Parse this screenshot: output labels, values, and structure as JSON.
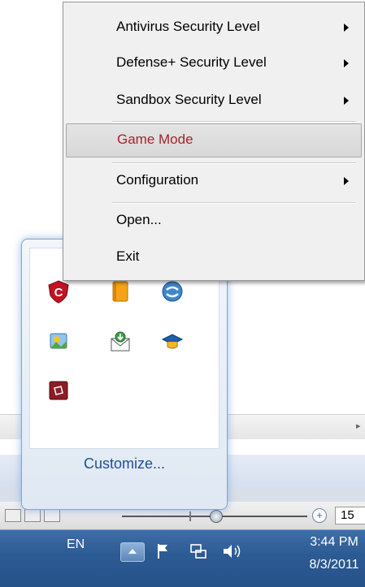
{
  "menu": {
    "items": [
      {
        "label": "Antivirus Security Level",
        "submenu": true
      },
      {
        "label": "Defense+ Security Level",
        "submenu": true
      },
      {
        "label": "Sandbox Security Level",
        "submenu": true
      },
      {
        "label": "Game Mode",
        "submenu": false,
        "highlighted": true
      },
      {
        "label": "Configuration",
        "submenu": true
      },
      {
        "label": "Open...",
        "submenu": false
      },
      {
        "label": "Exit",
        "submenu": false
      }
    ]
  },
  "flyout": {
    "icons": [
      "comodo-shield-icon",
      "notebook-icon",
      "network-sync-icon",
      "photo-icon",
      "mail-download-icon",
      "graduation-cap-icon",
      "maroon-app-icon"
    ],
    "customize_label": "Customize..."
  },
  "statusbar": {
    "zoom_value": "15"
  },
  "taskbar": {
    "language": "EN",
    "time": "3:44 PM",
    "date": "8/3/2011",
    "tray_icons": [
      "show-hidden-icons-button",
      "action-center-flag-icon",
      "network-icon",
      "volume-icon"
    ]
  },
  "colors": {
    "highlight_text": "#a3252b",
    "customize_link": "#1e4f9a",
    "taskbar": "#2c5a92"
  }
}
